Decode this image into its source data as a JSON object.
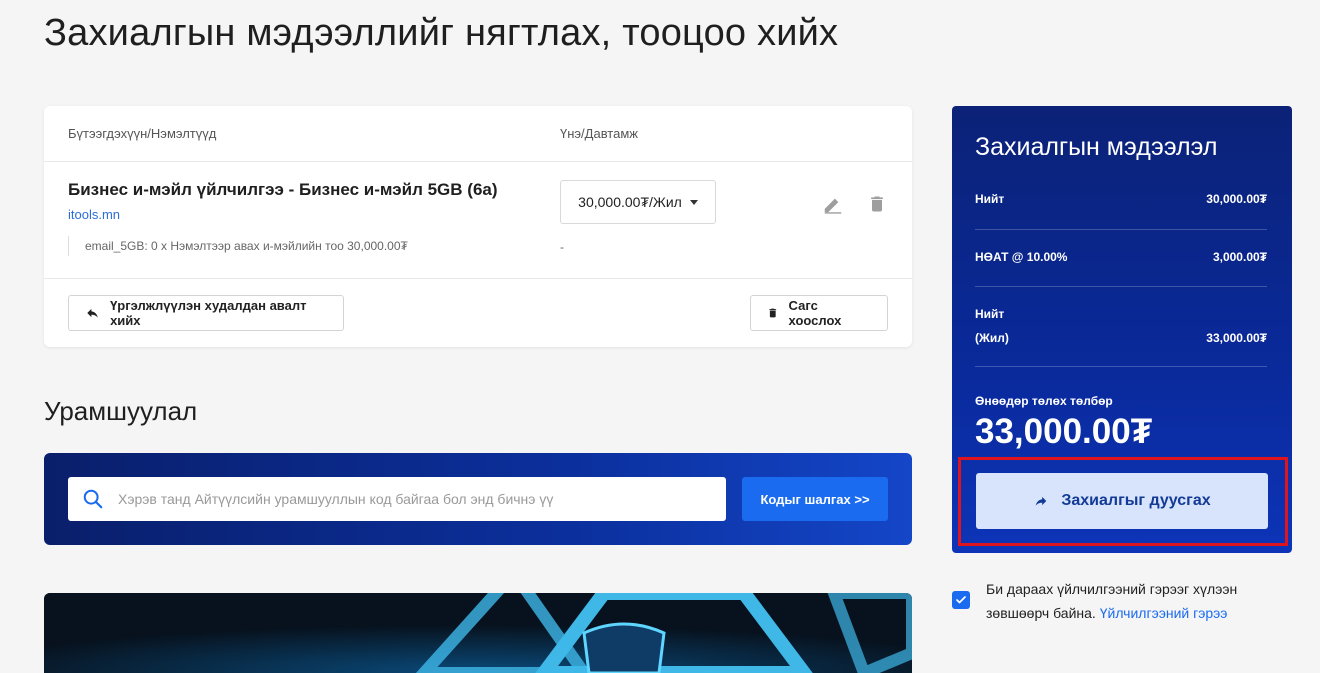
{
  "page": {
    "title": "Захиалгын мэдээллийг нягтлах, тооцоо хийх"
  },
  "cart": {
    "col_product": "Бүтээгдэхүүн/Нэмэлтүүд",
    "col_price": "Үнэ/Давтамж",
    "item": {
      "name": "Бизнес и-мэйл үйлчилгээ - Бизнес и-мэйл 5GB (6а)",
      "domain": "itools.mn",
      "addon": "email_5GB: 0 x Нэмэлтээр авах и-мэйлийн тоо 30,000.00₮",
      "price_select": "30,000.00₮/Жил",
      "addon_price": "-"
    },
    "continue_label": "Үргэлжлүүлэн худалдан авалт хийх",
    "empty_label": "Сагс хоослох"
  },
  "promo": {
    "title": "Урамшуулал",
    "placeholder": "Хэрэв танд Айтүүлсийн урамшууллын код байгаа бол энд бичнэ үү",
    "button": "Кодыг шалгах >>"
  },
  "summary": {
    "title": "Захиалгын мэдээлэл",
    "subtotal_label": "Нийт",
    "subtotal_value": "30,000.00₮",
    "vat_label": "НӨАТ @ 10.00%",
    "vat_value": "3,000.00₮",
    "total_label": "Нийт",
    "total_period": "(Жил)",
    "total_value": "33,000.00₮",
    "today_label": "Өнөөдөр төлөх төлбөр",
    "today_amount": "33,000.00₮",
    "checkout_label": "Захиалгыг дуусгах"
  },
  "tos": {
    "checked": true,
    "text": "Би дараах үйлчилгээний гэрээг хүлээн зөвшөөрч байна.",
    "link": "Үйлчилгээний гэрээ"
  },
  "colors": {
    "brand_blue": "#1a6bf0",
    "summary_bg": "#0b2277",
    "highlight": "#e0141e"
  },
  "icons": [
    "edit-icon",
    "trash-icon",
    "back-arrow-icon",
    "search-icon",
    "forward-arrow-icon",
    "checkmark-icon"
  ]
}
